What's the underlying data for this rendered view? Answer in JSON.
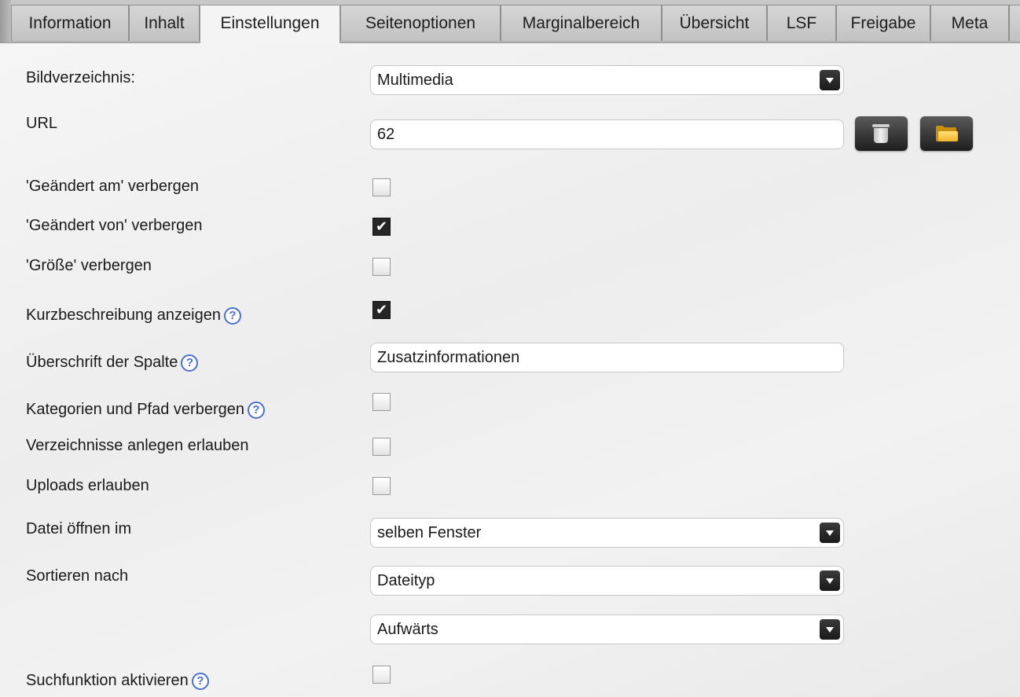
{
  "tabs": [
    {
      "label": "Information"
    },
    {
      "label": "Inhalt"
    },
    {
      "label": "Einstellungen",
      "active": true
    },
    {
      "label": "Seitenoptionen"
    },
    {
      "label": "Marginalbereich"
    },
    {
      "label": "Übersicht"
    },
    {
      "label": "LSF"
    },
    {
      "label": "Freigabe"
    },
    {
      "label": "Meta"
    }
  ],
  "form": {
    "bildverzeichnis": {
      "label": "Bildverzeichnis:",
      "value": "Multimedia"
    },
    "url": {
      "label": "URL",
      "value": "62",
      "delete_icon": "trash-icon",
      "browse_icon": "folder-icon"
    },
    "geaendert_am": {
      "label": "'Geändert am' verbergen",
      "checked": false
    },
    "geaendert_von": {
      "label": "'Geändert von' verbergen",
      "checked": true
    },
    "groesse": {
      "label": "'Größe' verbergen",
      "checked": false
    },
    "kurzbeschreibung": {
      "label": "Kurzbeschreibung anzeigen",
      "checked": true
    },
    "ueberschrift": {
      "label": "Überschrift der Spalte",
      "value": "Zusatzinformationen"
    },
    "kategorien": {
      "label": "Kategorien und Pfad verbergen",
      "checked": false
    },
    "verzeichnisse": {
      "label": "Verzeichnisse anlegen erlauben",
      "checked": false
    },
    "uploads": {
      "label": "Uploads erlauben",
      "checked": false
    },
    "datei_oeffnen": {
      "label": "Datei öffnen im",
      "value": "selben Fenster"
    },
    "sortieren": {
      "label": "Sortieren nach",
      "value": "Dateityp",
      "order_value": "Aufwärts"
    },
    "suchfunktion": {
      "label": "Suchfunktion aktivieren",
      "checked": false
    }
  },
  "help_glyph": "?",
  "check_glyph": "✔",
  "colors": {
    "help_icon": "#4d6fd0",
    "checkbox_checked": "#262626"
  }
}
